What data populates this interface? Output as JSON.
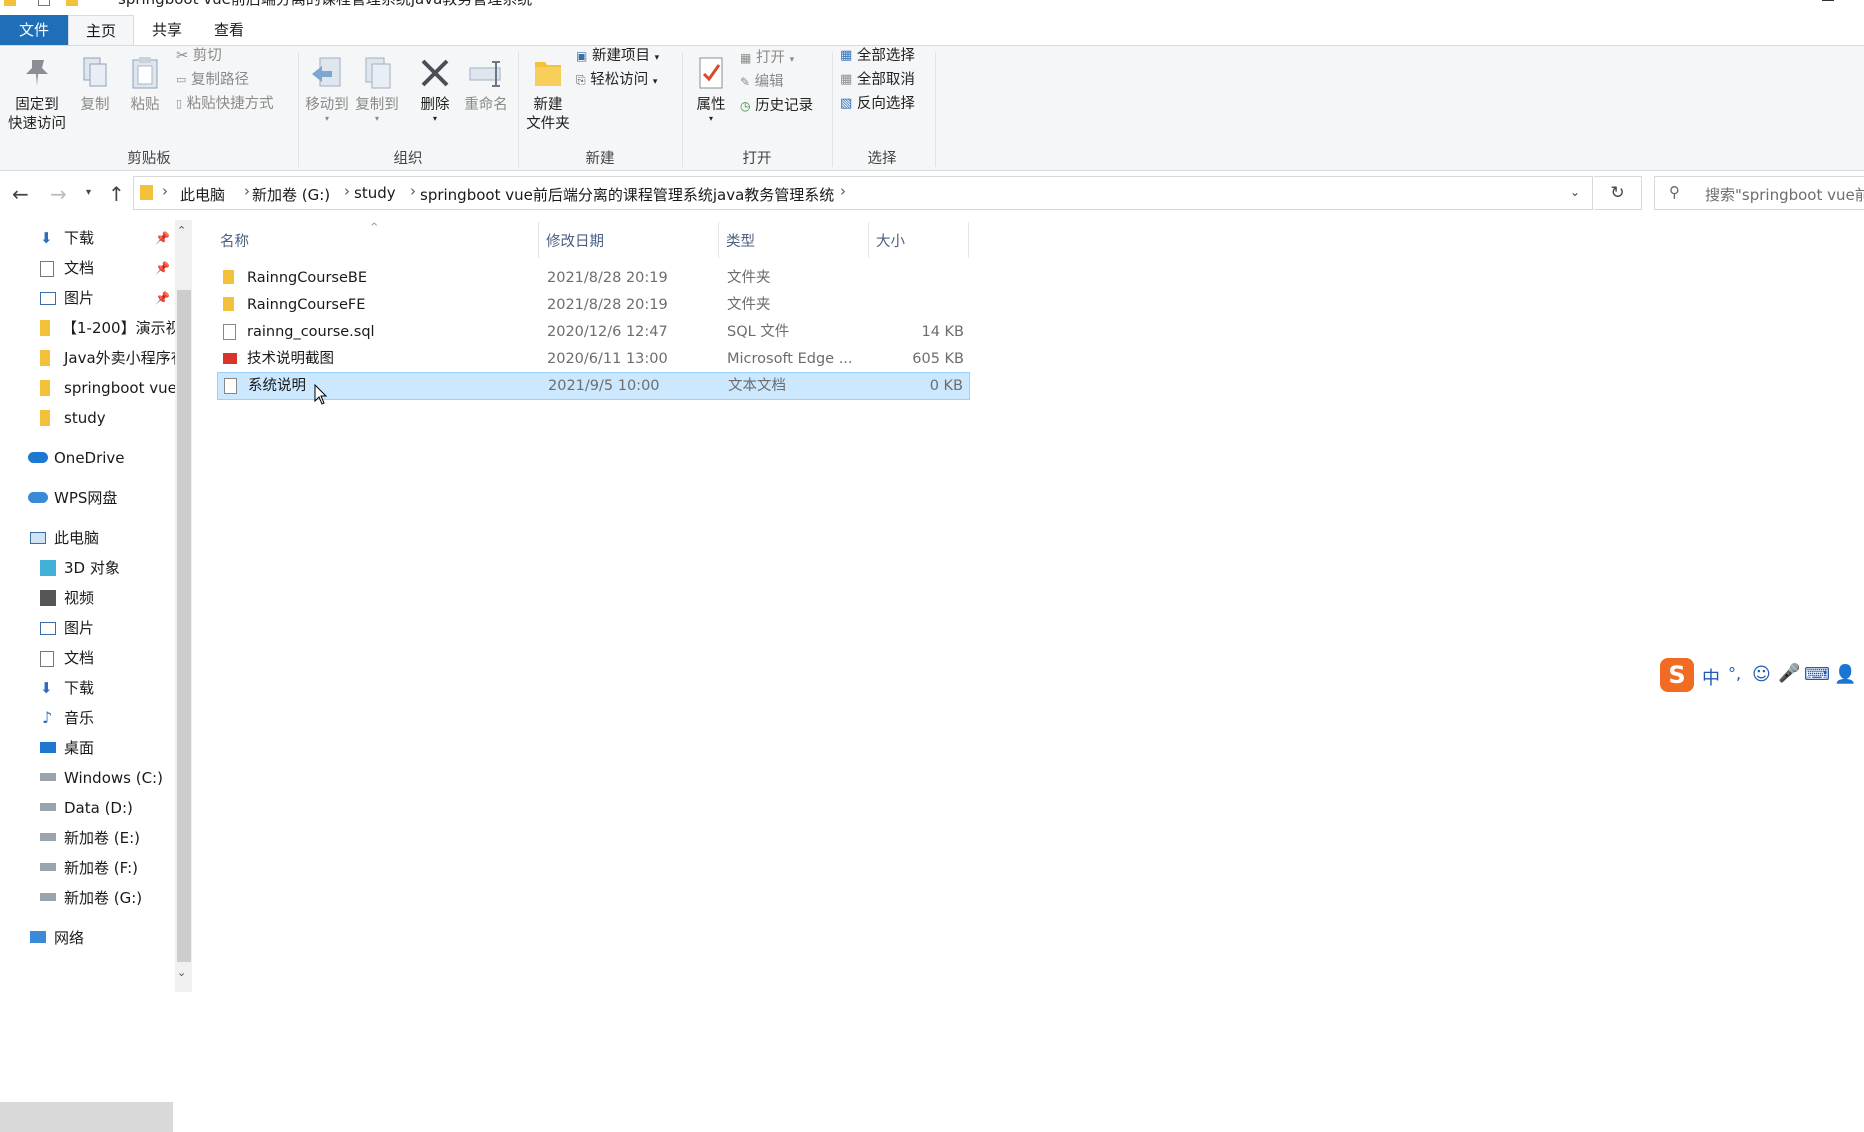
{
  "window": {
    "title": "springboot vue前后端分离的课程管理系统java教务管理系统"
  },
  "ribbon_tabs": [
    "文件",
    "主页",
    "共享",
    "查看"
  ],
  "ribbon": {
    "clipboard": {
      "label": "剪贴板",
      "pin": "固定到\n快速访问",
      "copy": "复制",
      "paste": "粘贴",
      "cut": "剪切",
      "copy_path": "复制路径",
      "paste_shortcut": "粘贴快捷方式"
    },
    "organize": {
      "label": "组织",
      "move_to": "移动到",
      "copy_to": "复制到",
      "delete": "删除",
      "rename": "重命名"
    },
    "new": {
      "label": "新建",
      "new_folder": "新建\n文件夹",
      "new_item": "新建项目",
      "easy_access": "轻松访问"
    },
    "open": {
      "label": "打开",
      "properties": "属性",
      "open": "打开",
      "edit": "编辑",
      "history": "历史记录"
    },
    "select": {
      "label": "选择",
      "select_all": "全部选择",
      "select_none": "全部取消",
      "invert": "反向选择"
    }
  },
  "breadcrumb": [
    "此电脑",
    "新加卷 (G:)",
    "study",
    "springboot vue前后端分离的课程管理系统java教务管理系统"
  ],
  "search": {
    "placeholder": "搜索\"springboot vue前"
  },
  "nav": {
    "quick": [
      {
        "label": "下载",
        "icon": "download-icon"
      },
      {
        "label": "文档",
        "icon": "document-icon"
      },
      {
        "label": "图片",
        "icon": "picture-icon"
      },
      {
        "label": "【1-200】演示视",
        "icon": "folder-icon"
      },
      {
        "label": "Java外卖小程序有",
        "icon": "folder-icon"
      },
      {
        "label": "springboot vue",
        "icon": "folder-icon"
      },
      {
        "label": "study",
        "icon": "folder-icon"
      }
    ],
    "onedrive": "OneDrive",
    "wps": "WPS网盘",
    "this_pc": "此电脑",
    "pc_items": [
      {
        "label": "3D 对象",
        "icon": "3d-objects-icon"
      },
      {
        "label": "视频",
        "icon": "video-icon"
      },
      {
        "label": "图片",
        "icon": "picture-icon"
      },
      {
        "label": "文档",
        "icon": "document-icon"
      },
      {
        "label": "下载",
        "icon": "download-icon"
      },
      {
        "label": "音乐",
        "icon": "music-icon"
      },
      {
        "label": "桌面",
        "icon": "desktop-icon"
      },
      {
        "label": "Windows (C:)",
        "icon": "drive-icon"
      },
      {
        "label": "Data (D:)",
        "icon": "drive-icon"
      },
      {
        "label": "新加卷 (E:)",
        "icon": "drive-icon"
      },
      {
        "label": "新加卷 (F:)",
        "icon": "drive-icon"
      },
      {
        "label": "新加卷 (G:)",
        "icon": "drive-icon"
      }
    ],
    "network": "网络"
  },
  "columns": {
    "name": "名称",
    "date": "修改日期",
    "type": "类型",
    "size": "大小"
  },
  "files": [
    {
      "name": "RainngCourseBE",
      "date": "2021/8/28 20:19",
      "type": "文件夹",
      "size": "",
      "icon": "folder-icon"
    },
    {
      "name": "RainngCourseFE",
      "date": "2021/8/28 20:19",
      "type": "文件夹",
      "size": "",
      "icon": "folder-icon"
    },
    {
      "name": "rainng_course.sql",
      "date": "2020/12/6 12:47",
      "type": "SQL 文件",
      "size": "14 KB",
      "icon": "file-icon"
    },
    {
      "name": "技术说明截图",
      "date": "2020/6/11 13:00",
      "type": "Microsoft Edge ...",
      "size": "605 KB",
      "icon": "pdf-icon"
    },
    {
      "name": "系统说明",
      "date": "2021/9/5 10:00",
      "type": "文本文档",
      "size": "0 KB",
      "icon": "text-file-icon"
    }
  ],
  "ime": {
    "label": "中"
  },
  "colors": {
    "accent": "#1e6fb8",
    "selection": "#cce8ff",
    "folder": "#f4c13a"
  }
}
